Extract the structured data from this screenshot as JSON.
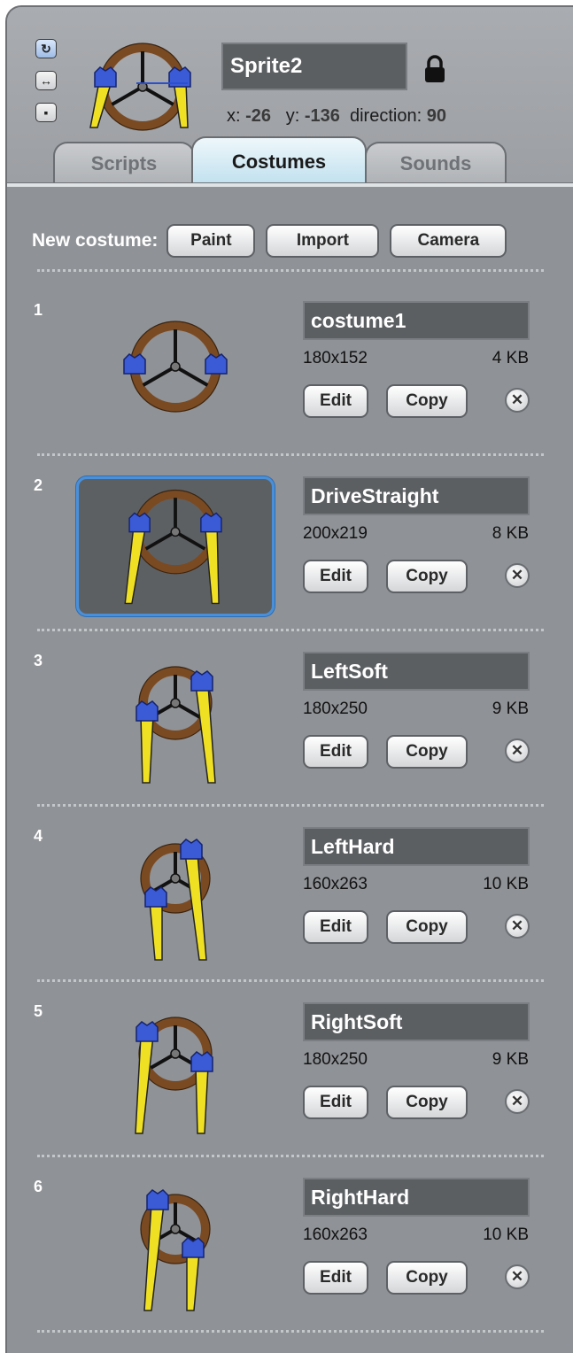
{
  "sprite": {
    "name": "Sprite2",
    "x_label": "x:",
    "x": "-26",
    "y_label": "y:",
    "y": "-136",
    "direction_label": "direction:",
    "direction": "90",
    "rotation_buttons": [
      "rotate-icon",
      "left-right-icon",
      "no-rotate-icon"
    ]
  },
  "tabs": [
    {
      "label": "Scripts",
      "active": false
    },
    {
      "label": "Costumes",
      "active": true
    },
    {
      "label": "Sounds",
      "active": false
    }
  ],
  "new_costume": {
    "label": "New costume:",
    "buttons": [
      "Paint",
      "Import",
      "Camera"
    ]
  },
  "costumes": [
    {
      "num": "1",
      "name": "costume1",
      "size": "180x152",
      "kb": "4 KB",
      "edit": "Edit",
      "copy": "Copy",
      "pose": "wheel"
    },
    {
      "num": "2",
      "name": "DriveStraight",
      "size": "200x219",
      "kb": "8 KB",
      "edit": "Edit",
      "copy": "Copy",
      "pose": "straight"
    },
    {
      "num": "3",
      "name": "LeftSoft",
      "size": "180x250",
      "kb": "9 KB",
      "edit": "Edit",
      "copy": "Copy",
      "pose": "leftsoft"
    },
    {
      "num": "4",
      "name": "LeftHard",
      "size": "160x263",
      "kb": "10 KB",
      "edit": "Edit",
      "copy": "Copy",
      "pose": "lefthard"
    },
    {
      "num": "5",
      "name": "RightSoft",
      "size": "180x250",
      "kb": "9 KB",
      "edit": "Edit",
      "copy": "Copy",
      "pose": "rightsoft"
    },
    {
      "num": "6",
      "name": "RightHard",
      "size": "160x263",
      "kb": "10 KB",
      "edit": "Edit",
      "copy": "Copy",
      "pose": "righthard"
    }
  ],
  "selected_costume": 2,
  "colors": {
    "panel": "#8f9296",
    "wheel": "#7a4a22",
    "hands": "#3b5bd6",
    "arms": "#f0e024",
    "selection": "#4a90d9"
  }
}
